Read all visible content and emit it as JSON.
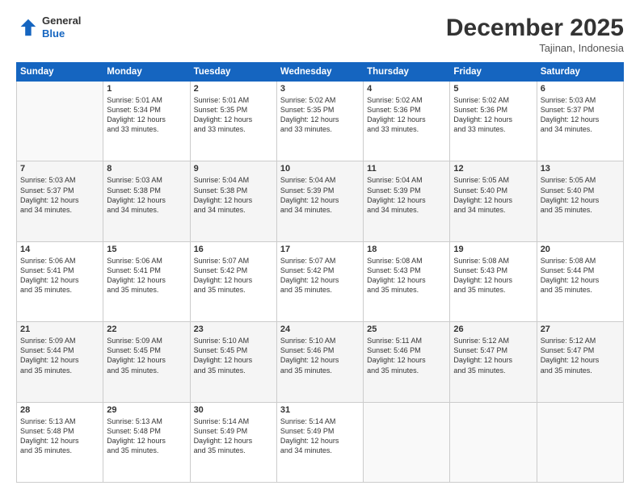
{
  "header": {
    "logo_line1": "General",
    "logo_line2": "Blue",
    "month": "December 2025",
    "location": "Tajinan, Indonesia"
  },
  "days_of_week": [
    "Sunday",
    "Monday",
    "Tuesday",
    "Wednesday",
    "Thursday",
    "Friday",
    "Saturday"
  ],
  "weeks": [
    {
      "shade": false,
      "cells": [
        {
          "num": "",
          "lines": []
        },
        {
          "num": "1",
          "lines": [
            "Sunrise: 5:01 AM",
            "Sunset: 5:34 PM",
            "Daylight: 12 hours",
            "and 33 minutes."
          ]
        },
        {
          "num": "2",
          "lines": [
            "Sunrise: 5:01 AM",
            "Sunset: 5:35 PM",
            "Daylight: 12 hours",
            "and 33 minutes."
          ]
        },
        {
          "num": "3",
          "lines": [
            "Sunrise: 5:02 AM",
            "Sunset: 5:35 PM",
            "Daylight: 12 hours",
            "and 33 minutes."
          ]
        },
        {
          "num": "4",
          "lines": [
            "Sunrise: 5:02 AM",
            "Sunset: 5:36 PM",
            "Daylight: 12 hours",
            "and 33 minutes."
          ]
        },
        {
          "num": "5",
          "lines": [
            "Sunrise: 5:02 AM",
            "Sunset: 5:36 PM",
            "Daylight: 12 hours",
            "and 33 minutes."
          ]
        },
        {
          "num": "6",
          "lines": [
            "Sunrise: 5:03 AM",
            "Sunset: 5:37 PM",
            "Daylight: 12 hours",
            "and 34 minutes."
          ]
        }
      ]
    },
    {
      "shade": true,
      "cells": [
        {
          "num": "7",
          "lines": [
            "Sunrise: 5:03 AM",
            "Sunset: 5:37 PM",
            "Daylight: 12 hours",
            "and 34 minutes."
          ]
        },
        {
          "num": "8",
          "lines": [
            "Sunrise: 5:03 AM",
            "Sunset: 5:38 PM",
            "Daylight: 12 hours",
            "and 34 minutes."
          ]
        },
        {
          "num": "9",
          "lines": [
            "Sunrise: 5:04 AM",
            "Sunset: 5:38 PM",
            "Daylight: 12 hours",
            "and 34 minutes."
          ]
        },
        {
          "num": "10",
          "lines": [
            "Sunrise: 5:04 AM",
            "Sunset: 5:39 PM",
            "Daylight: 12 hours",
            "and 34 minutes."
          ]
        },
        {
          "num": "11",
          "lines": [
            "Sunrise: 5:04 AM",
            "Sunset: 5:39 PM",
            "Daylight: 12 hours",
            "and 34 minutes."
          ]
        },
        {
          "num": "12",
          "lines": [
            "Sunrise: 5:05 AM",
            "Sunset: 5:40 PM",
            "Daylight: 12 hours",
            "and 34 minutes."
          ]
        },
        {
          "num": "13",
          "lines": [
            "Sunrise: 5:05 AM",
            "Sunset: 5:40 PM",
            "Daylight: 12 hours",
            "and 35 minutes."
          ]
        }
      ]
    },
    {
      "shade": false,
      "cells": [
        {
          "num": "14",
          "lines": [
            "Sunrise: 5:06 AM",
            "Sunset: 5:41 PM",
            "Daylight: 12 hours",
            "and 35 minutes."
          ]
        },
        {
          "num": "15",
          "lines": [
            "Sunrise: 5:06 AM",
            "Sunset: 5:41 PM",
            "Daylight: 12 hours",
            "and 35 minutes."
          ]
        },
        {
          "num": "16",
          "lines": [
            "Sunrise: 5:07 AM",
            "Sunset: 5:42 PM",
            "Daylight: 12 hours",
            "and 35 minutes."
          ]
        },
        {
          "num": "17",
          "lines": [
            "Sunrise: 5:07 AM",
            "Sunset: 5:42 PM",
            "Daylight: 12 hours",
            "and 35 minutes."
          ]
        },
        {
          "num": "18",
          "lines": [
            "Sunrise: 5:08 AM",
            "Sunset: 5:43 PM",
            "Daylight: 12 hours",
            "and 35 minutes."
          ]
        },
        {
          "num": "19",
          "lines": [
            "Sunrise: 5:08 AM",
            "Sunset: 5:43 PM",
            "Daylight: 12 hours",
            "and 35 minutes."
          ]
        },
        {
          "num": "20",
          "lines": [
            "Sunrise: 5:08 AM",
            "Sunset: 5:44 PM",
            "Daylight: 12 hours",
            "and 35 minutes."
          ]
        }
      ]
    },
    {
      "shade": true,
      "cells": [
        {
          "num": "21",
          "lines": [
            "Sunrise: 5:09 AM",
            "Sunset: 5:44 PM",
            "Daylight: 12 hours",
            "and 35 minutes."
          ]
        },
        {
          "num": "22",
          "lines": [
            "Sunrise: 5:09 AM",
            "Sunset: 5:45 PM",
            "Daylight: 12 hours",
            "and 35 minutes."
          ]
        },
        {
          "num": "23",
          "lines": [
            "Sunrise: 5:10 AM",
            "Sunset: 5:45 PM",
            "Daylight: 12 hours",
            "and 35 minutes."
          ]
        },
        {
          "num": "24",
          "lines": [
            "Sunrise: 5:10 AM",
            "Sunset: 5:46 PM",
            "Daylight: 12 hours",
            "and 35 minutes."
          ]
        },
        {
          "num": "25",
          "lines": [
            "Sunrise: 5:11 AM",
            "Sunset: 5:46 PM",
            "Daylight: 12 hours",
            "and 35 minutes."
          ]
        },
        {
          "num": "26",
          "lines": [
            "Sunrise: 5:12 AM",
            "Sunset: 5:47 PM",
            "Daylight: 12 hours",
            "and 35 minutes."
          ]
        },
        {
          "num": "27",
          "lines": [
            "Sunrise: 5:12 AM",
            "Sunset: 5:47 PM",
            "Daylight: 12 hours",
            "and 35 minutes."
          ]
        }
      ]
    },
    {
      "shade": false,
      "cells": [
        {
          "num": "28",
          "lines": [
            "Sunrise: 5:13 AM",
            "Sunset: 5:48 PM",
            "Daylight: 12 hours",
            "and 35 minutes."
          ]
        },
        {
          "num": "29",
          "lines": [
            "Sunrise: 5:13 AM",
            "Sunset: 5:48 PM",
            "Daylight: 12 hours",
            "and 35 minutes."
          ]
        },
        {
          "num": "30",
          "lines": [
            "Sunrise: 5:14 AM",
            "Sunset: 5:49 PM",
            "Daylight: 12 hours",
            "and 35 minutes."
          ]
        },
        {
          "num": "31",
          "lines": [
            "Sunrise: 5:14 AM",
            "Sunset: 5:49 PM",
            "Daylight: 12 hours",
            "and 34 minutes."
          ]
        },
        {
          "num": "",
          "lines": []
        },
        {
          "num": "",
          "lines": []
        },
        {
          "num": "",
          "lines": []
        }
      ]
    }
  ]
}
